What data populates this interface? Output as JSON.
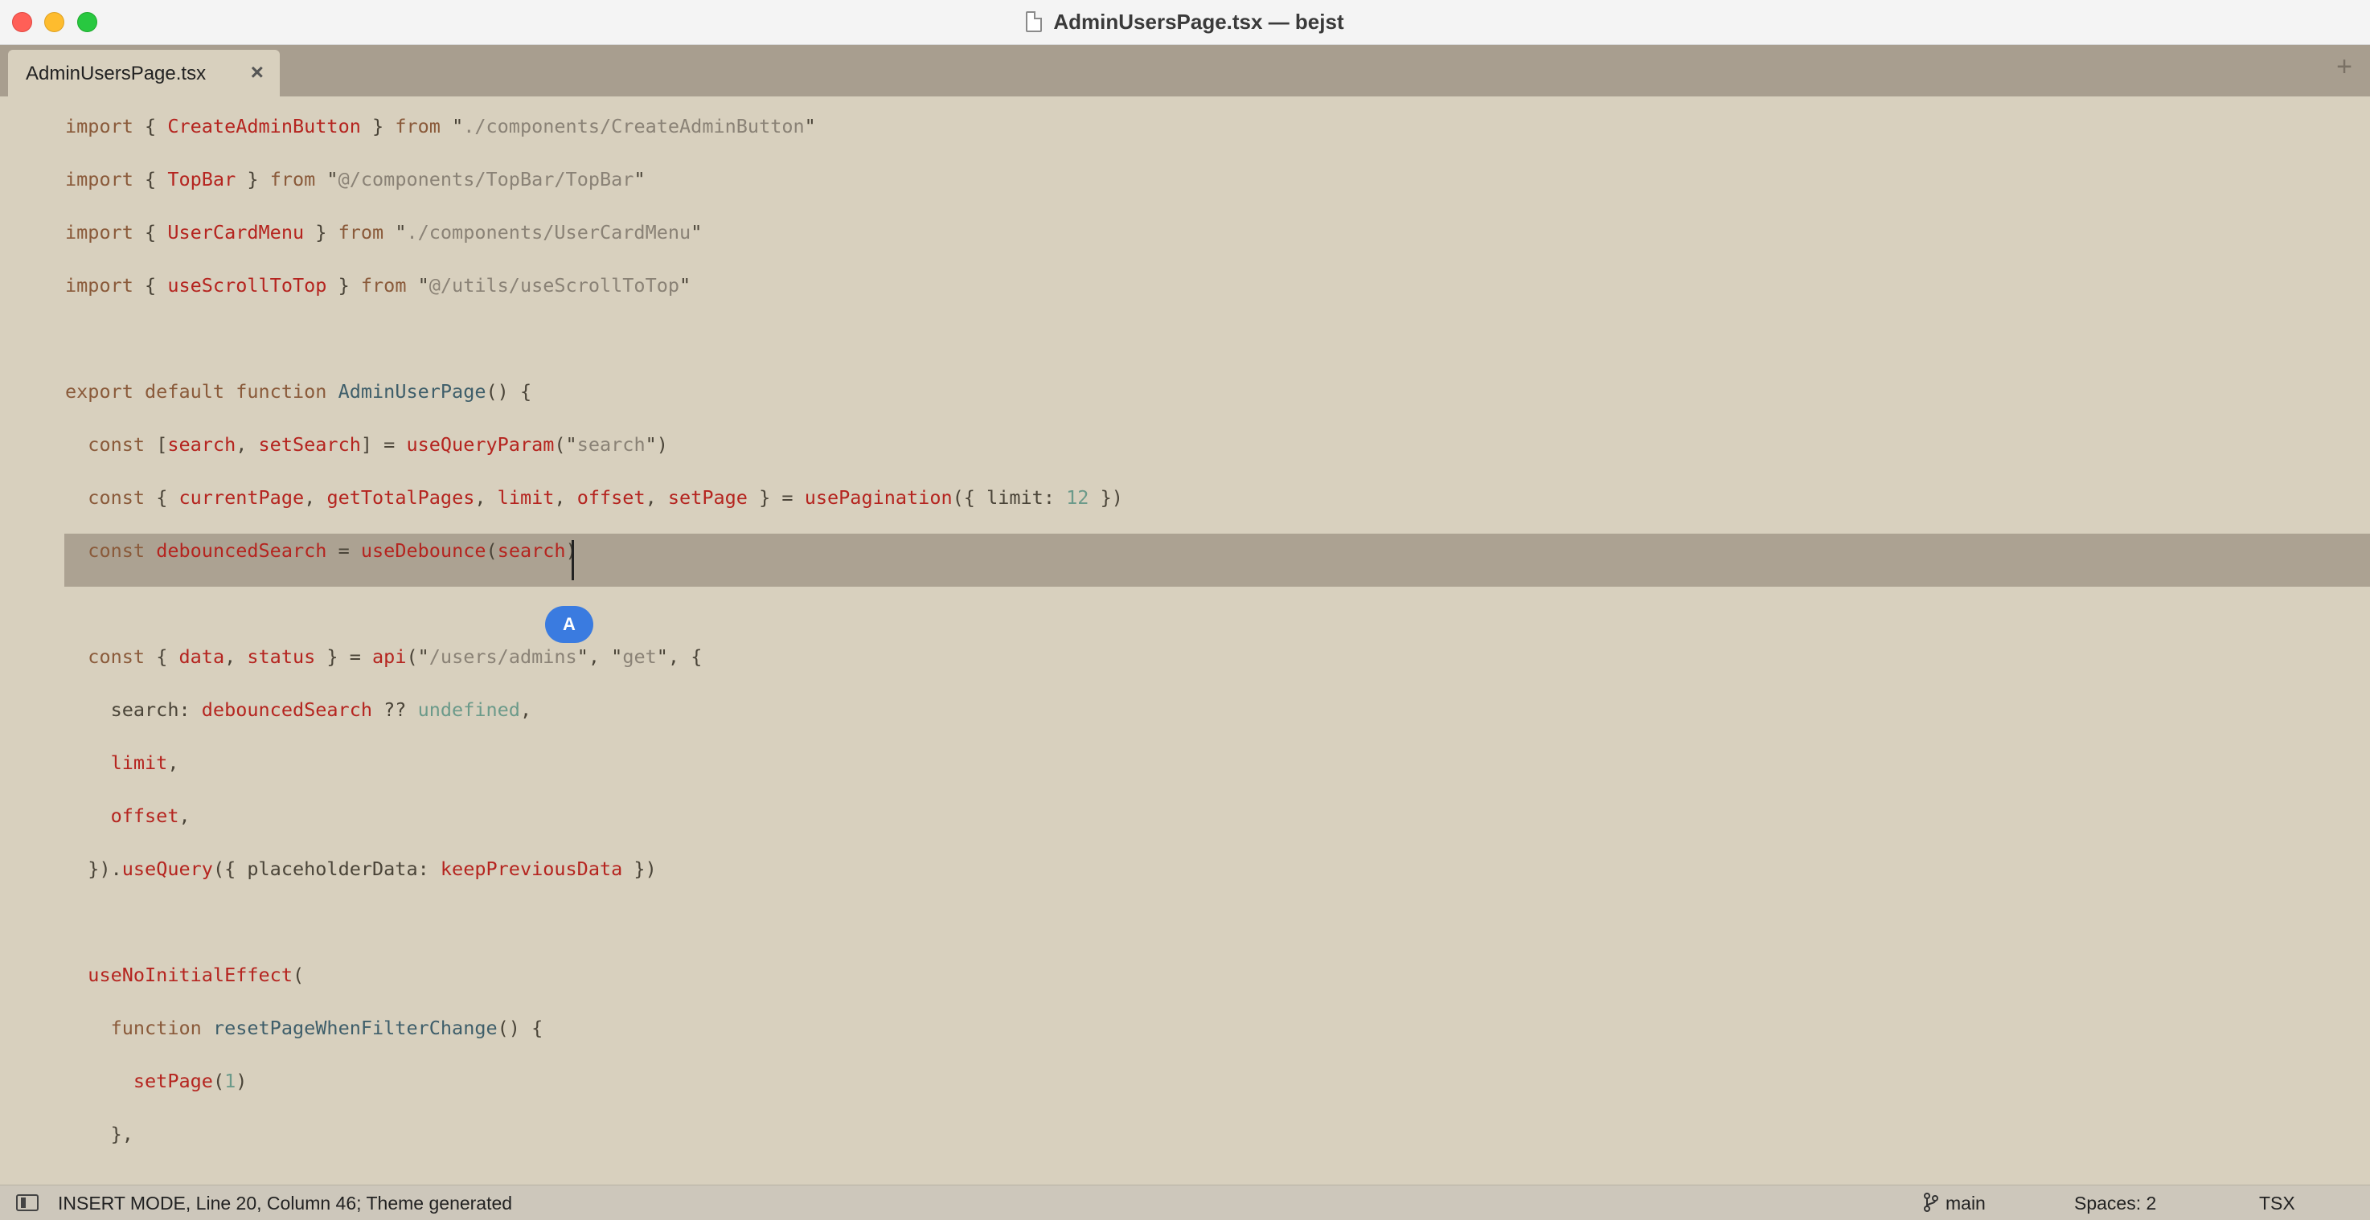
{
  "window": {
    "title": "AdminUsersPage.tsx — bejst"
  },
  "tabs": [
    {
      "label": "AdminUsersPage.tsx",
      "close": "×"
    }
  ],
  "tab_add": "+",
  "code": {
    "lines": [
      [
        [
          "kw",
          "import"
        ],
        [
          "pl",
          " { "
        ],
        [
          "id",
          "CreateAdminButton"
        ],
        [
          "pl",
          " } "
        ],
        [
          "kw",
          "from"
        ],
        [
          "pl",
          " \""
        ],
        [
          "str",
          "./components/CreateAdminButton"
        ],
        [
          "pl",
          "\""
        ]
      ],
      [
        [
          "kw",
          "import"
        ],
        [
          "pl",
          " { "
        ],
        [
          "id",
          "TopBar"
        ],
        [
          "pl",
          " } "
        ],
        [
          "kw",
          "from"
        ],
        [
          "pl",
          " \""
        ],
        [
          "str",
          "@/components/TopBar/TopBar"
        ],
        [
          "pl",
          "\""
        ]
      ],
      [
        [
          "kw",
          "import"
        ],
        [
          "pl",
          " { "
        ],
        [
          "id",
          "UserCardMenu"
        ],
        [
          "pl",
          " } "
        ],
        [
          "kw",
          "from"
        ],
        [
          "pl",
          " \""
        ],
        [
          "str",
          "./components/UserCardMenu"
        ],
        [
          "pl",
          "\""
        ]
      ],
      [
        [
          "kw",
          "import"
        ],
        [
          "pl",
          " { "
        ],
        [
          "id",
          "useScrollToTop"
        ],
        [
          "pl",
          " } "
        ],
        [
          "kw",
          "from"
        ],
        [
          "pl",
          " \""
        ],
        [
          "str",
          "@/utils/useScrollToTop"
        ],
        [
          "pl",
          "\""
        ]
      ],
      [],
      [
        [
          "kw",
          "export default function"
        ],
        [
          "pl",
          " "
        ],
        [
          "fn",
          "AdminUserPage"
        ],
        [
          "pl",
          "() {"
        ]
      ],
      [
        [
          "kw",
          "  const"
        ],
        [
          "pl",
          " ["
        ],
        [
          "id",
          "search"
        ],
        [
          "pl",
          ", "
        ],
        [
          "id",
          "setSearch"
        ],
        [
          "pl",
          "] = "
        ],
        [
          "id",
          "useQueryParam"
        ],
        [
          "pl",
          "(\""
        ],
        [
          "str",
          "search"
        ],
        [
          "pl",
          "\")"
        ]
      ],
      [
        [
          "kw",
          "  const"
        ],
        [
          "pl",
          " { "
        ],
        [
          "id",
          "currentPage"
        ],
        [
          "pl",
          ", "
        ],
        [
          "id",
          "getTotalPages"
        ],
        [
          "pl",
          ", "
        ],
        [
          "id",
          "limit"
        ],
        [
          "pl",
          ", "
        ],
        [
          "id",
          "offset"
        ],
        [
          "pl",
          ", "
        ],
        [
          "id",
          "setPage"
        ],
        [
          "pl",
          " } = "
        ],
        [
          "id",
          "usePagination"
        ],
        [
          "pl",
          "({ limit: "
        ],
        [
          "num",
          "12"
        ],
        [
          "pl",
          " })"
        ]
      ],
      [
        [
          "kw",
          "  const"
        ],
        [
          "pl",
          " "
        ],
        [
          "id",
          "debouncedSearch"
        ],
        [
          "pl",
          " = "
        ],
        [
          "id",
          "useDebounce"
        ],
        [
          "pl",
          "("
        ],
        [
          "id",
          "search"
        ],
        [
          "pl",
          ")"
        ]
      ],
      [],
      [
        [
          "kw",
          "  const"
        ],
        [
          "pl",
          " { "
        ],
        [
          "id",
          "data"
        ],
        [
          "pl",
          ", "
        ],
        [
          "id",
          "status"
        ],
        [
          "pl",
          " } = "
        ],
        [
          "id",
          "api"
        ],
        [
          "pl",
          "(\""
        ],
        [
          "str",
          "/users/admins"
        ],
        [
          "pl",
          "\", \""
        ],
        [
          "str",
          "get"
        ],
        [
          "pl",
          "\", {"
        ]
      ],
      [
        [
          "pl",
          "    search: "
        ],
        [
          "id",
          "debouncedSearch"
        ],
        [
          "pl",
          " ?? "
        ],
        [
          "num",
          "undefined"
        ],
        [
          "pl",
          ","
        ]
      ],
      [
        [
          "id",
          "    limit"
        ],
        [
          "pl",
          ","
        ]
      ],
      [
        [
          "id",
          "    offset"
        ],
        [
          "pl",
          ","
        ]
      ],
      [
        [
          "pl",
          "  })."
        ],
        [
          "id",
          "useQuery"
        ],
        [
          "pl",
          "({ placeholderData: "
        ],
        [
          "id",
          "keepPreviousData"
        ],
        [
          "pl",
          " })"
        ]
      ],
      [],
      [
        [
          "id",
          "  useNoInitialEffect"
        ],
        [
          "pl",
          "("
        ]
      ],
      [
        [
          "kw",
          "    function"
        ],
        [
          "pl",
          " "
        ],
        [
          "fn",
          "resetPageWhenFilterChange"
        ],
        [
          "pl",
          "() {"
        ]
      ],
      [
        [
          "id",
          "      setPage"
        ],
        [
          "pl",
          "("
        ],
        [
          "num",
          "1"
        ],
        [
          "pl",
          ")"
        ]
      ],
      [
        [
          "pl",
          "    },"
        ]
      ]
    ]
  },
  "cursor_badge": "A",
  "status": {
    "left": "INSERT MODE, Line 20, Column 46; Theme generated",
    "branch": "main",
    "spaces": "Spaces: 2",
    "language": "TSX"
  },
  "colors": {
    "keyword": "#8a5a3a",
    "identifier": "#b5241f",
    "string": "#8a8276",
    "number": "#6b9a8a",
    "function_name": "#3e5e6a",
    "editor_bg": "#d8d0be",
    "tabbar_bg": "#a89e8f",
    "highlight_line": "#aca292",
    "badge": "#3a7be0"
  }
}
